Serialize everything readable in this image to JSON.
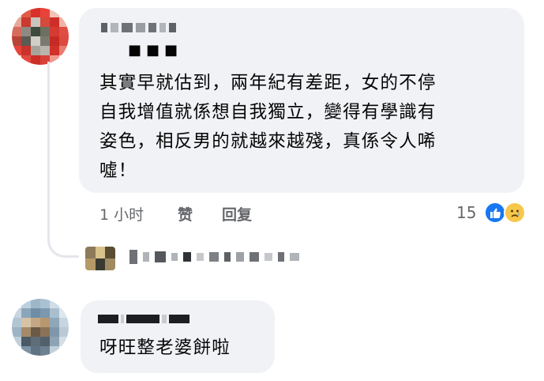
{
  "comment1": {
    "dots": "■■■",
    "lines": [
      "其實早就估到，兩年紀有差距，女的不停",
      "自我增值就係想自我獨立，變得有學識有",
      "姿色，相反男的就越來越殘，真係令人唏",
      "噓！"
    ],
    "time": "1 小时",
    "like_label": "赞",
    "reply_label": "回复",
    "reaction_count": "15",
    "reactions": [
      "like-icon",
      "sad-face-icon"
    ]
  },
  "comment2": {
    "text": "呀旺整老婆餅啦"
  },
  "colors": {
    "bubble": "#f0f2f5",
    "meta_text": "#65676b",
    "like_blue": "#1877f2",
    "sad_yellow": "#f7c74b"
  }
}
